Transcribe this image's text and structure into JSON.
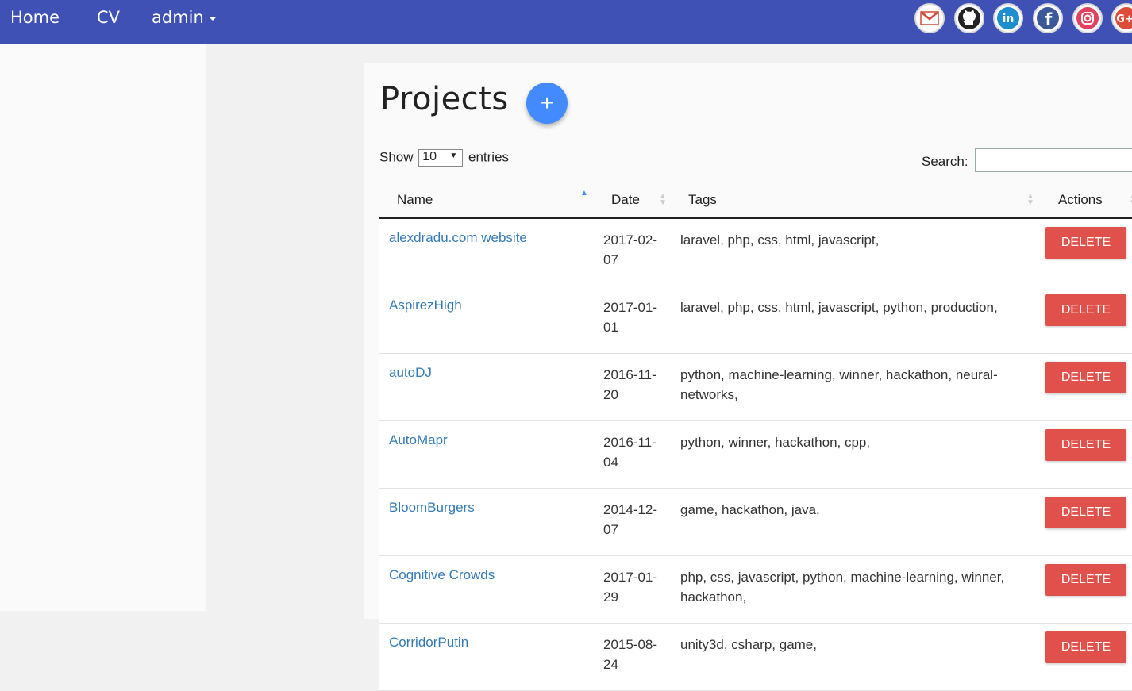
{
  "nav": {
    "home": "Home",
    "cv": "CV",
    "admin": "admin"
  },
  "social_icons": [
    "gmail-icon",
    "github-icon",
    "linkedin-icon",
    "facebook-icon",
    "instagram-icon",
    "google-plus-icon"
  ],
  "colors": {
    "navbar": "#3f51b5",
    "fab": "#448aff",
    "delete": "#e0514c",
    "link": "#337ab7"
  },
  "page": {
    "title": "Projects",
    "add_label": "+"
  },
  "controls": {
    "show_label": "Show",
    "entries_value": "10",
    "entries_label": "entries",
    "search_label": "Search:"
  },
  "table": {
    "columns": [
      "Name",
      "Date",
      "Tags",
      "Actions"
    ],
    "rows": [
      {
        "name": "alexdradu.com website",
        "date": "2017-02-07",
        "tags": "laravel,  php,  css,  html,  javascript,",
        "action": "DELETE"
      },
      {
        "name": "AspirezHigh",
        "date": "2017-01-01",
        "tags": "laravel,  php,  css,  html,  javascript,  python,  production,",
        "action": "DELETE"
      },
      {
        "name": "autoDJ",
        "date": "2016-11-20",
        "tags": "python,  machine-learning,  winner,  hackathon,  neural-networks,",
        "action": "DELETE"
      },
      {
        "name": "AutoMapr",
        "date": "2016-11-04",
        "tags": "python,  winner,  hackathon,  cpp,",
        "action": "DELETE"
      },
      {
        "name": "BloomBurgers",
        "date": "2014-12-07",
        "tags": "game,  hackathon,  java,",
        "action": "DELETE"
      },
      {
        "name": "Cognitive Crowds",
        "date": "2017-01-29",
        "tags": "php,  css,  javascript,  python,  machine-learning,  winner,  hackathon,",
        "action": "DELETE"
      },
      {
        "name": "CorridorPutin",
        "date": "2015-08-24",
        "tags": "unity3d,  csharp,  game,",
        "action": "DELETE"
      }
    ]
  }
}
